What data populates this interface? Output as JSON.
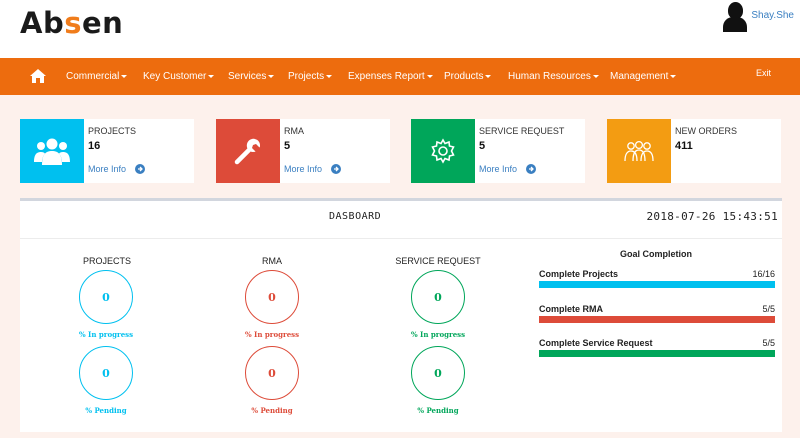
{
  "header": {
    "logo_prefix": "Ab",
    "logo_accent": "s",
    "logo_suffix": "en",
    "user_name": "Shay.She"
  },
  "nav": {
    "home_icon": "home-icon",
    "items": [
      "Commercial",
      "Key Customer",
      "Services",
      "Projects",
      "Expenses Report",
      "Products",
      "Human Resources",
      "Management"
    ],
    "exit": "Exit"
  },
  "cards": [
    {
      "label": "PROJECTS",
      "value": "16",
      "more": "More Info",
      "icon": "users-icon",
      "color": "#00c0ef"
    },
    {
      "label": "RMA",
      "value": "5",
      "more": "More Info",
      "icon": "wrench-icon",
      "color": "#dd4b39"
    },
    {
      "label": "SERVICE REQUEST",
      "value": "5",
      "more": "More Info",
      "icon": "gear-icon",
      "color": "#00a65a"
    },
    {
      "label": "NEW ORDERS",
      "value": "411",
      "icon": "team-icon",
      "color": "#f39c12"
    }
  ],
  "dashboard": {
    "title": "DASBOARD",
    "datetime": "2018-07-26 15:43:51",
    "columns": [
      {
        "title": "PROJECTS",
        "color": "#00c0ef",
        "in_progress": "0",
        "in_progress_label": "% In progress",
        "pending": "0",
        "pending_label": "% Pending"
      },
      {
        "title": "RMA",
        "color": "#dd4b39",
        "in_progress": "0",
        "in_progress_label": "% In progress",
        "pending": "0",
        "pending_label": "% Pending"
      },
      {
        "title": "SERVICE REQUEST",
        "color": "#00a65a",
        "in_progress": "0",
        "in_progress_label": "% In progress",
        "pending": "0",
        "pending_label": "% Pending"
      }
    ]
  },
  "goals": {
    "title": "Goal Completion",
    "items": [
      {
        "name": "Complete Projects",
        "count": "16/16",
        "fraction": 1.0,
        "color": "#00c0ef"
      },
      {
        "name": "Complete RMA",
        "count": "5/5",
        "fraction": 1.0,
        "color": "#dd4b39"
      },
      {
        "name": "Complete Service Request",
        "count": "5/5",
        "fraction": 1.0,
        "color": "#00a65a"
      }
    ]
  }
}
